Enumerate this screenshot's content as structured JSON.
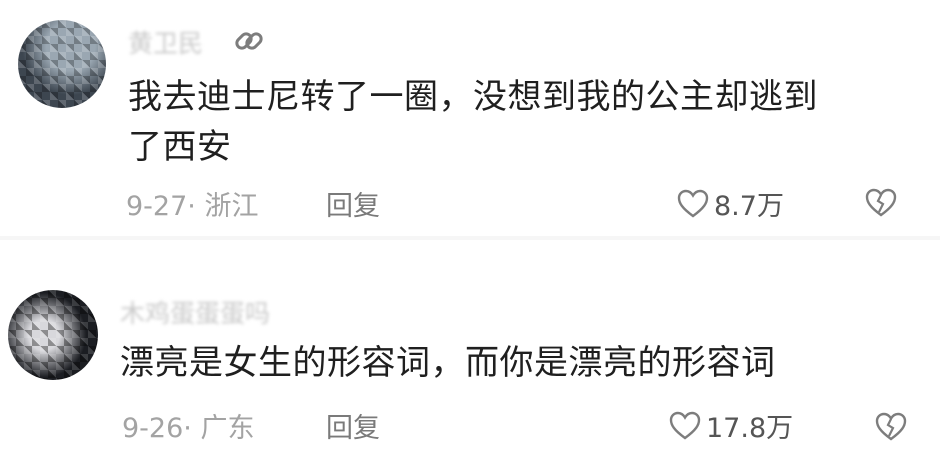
{
  "comments": [
    {
      "username": "黄卫民",
      "content_lines": [
        "我去迪士尼转了一圈，没想到我的公主却逃到",
        "了西安"
      ],
      "date_location": "9-27· 浙江",
      "reply_label": "回复",
      "likes": "8.7万"
    },
    {
      "username": "木鸡蛋蛋蛋吗",
      "content_lines": [
        "漂亮是女生的形容词，而你是漂亮的形容词"
      ],
      "date_location": "9-26· 广东",
      "reply_label": "回复",
      "likes": "17.8万"
    }
  ],
  "colors": {
    "text": "#1f1f1f",
    "meta": "#a3a3a3",
    "icon": "#7d7d7d"
  },
  "icons": {
    "link": "link-icon",
    "like": "heart-icon",
    "dislike": "broken-heart-icon"
  }
}
